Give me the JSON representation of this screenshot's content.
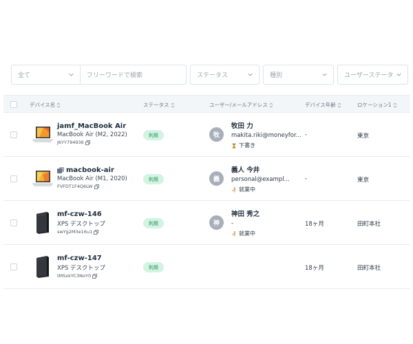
{
  "filters": {
    "all": "全て",
    "search_placeholder": "フリーワードで検索",
    "status": "ステータス",
    "type": "種別",
    "user_status": "ユーザーステータ"
  },
  "table": {
    "headers": {
      "device": "デバイス名",
      "status": "ステータス",
      "user": "ユーザー/メールアドレス",
      "age": "デバイス年齢",
      "location": "ロケーション1"
    },
    "rows": [
      {
        "device_name": "jamf_MacBook Air",
        "model": "MacBook Air (M2, 2022)",
        "serial": "J6YY794936",
        "status": "利用",
        "avatar": "牧",
        "user_name": "牧田 力",
        "email": "makita.riki@moneyfor...",
        "user_state": "下書き",
        "age": "-",
        "location": "東京"
      },
      {
        "device_name": "macbook-air",
        "model": "MacBook Air (M1, 2020)",
        "serial": "FVFDT1F4Q6LW",
        "status": "利用",
        "avatar": "義",
        "user_name": "義人 今井",
        "email": "personal@exampl...",
        "user_state": "就業中",
        "age": "-",
        "location": "東京"
      },
      {
        "device_name": "mf-czw-146",
        "model": "XPS デスクトップ",
        "serial": "swYg2M3e16u1",
        "status": "利用",
        "avatar": "神",
        "user_name": "神田 秀之",
        "email": "-",
        "user_state": "就業中",
        "age": "18ヶ月",
        "location": "田町本社"
      },
      {
        "device_name": "mf-czw-147",
        "model": "XPS デスクトップ",
        "serial": "tMSxkYC3NoY0",
        "status": "利用",
        "age": "18ヶ月",
        "location": "田町本社"
      }
    ]
  },
  "colors": {
    "badge_bg": "#d3f3e3",
    "badge_text": "#1c8a55",
    "avatar_bg": "#a7b0ba",
    "header_bg": "#f3f6f9"
  },
  "icons": [
    "chevron-down-icon",
    "sort-icon",
    "copy-icon",
    "laptop-icon",
    "desktop-tower-icon",
    "hourglass-icon",
    "running-icon",
    "user-shared-icon"
  ]
}
